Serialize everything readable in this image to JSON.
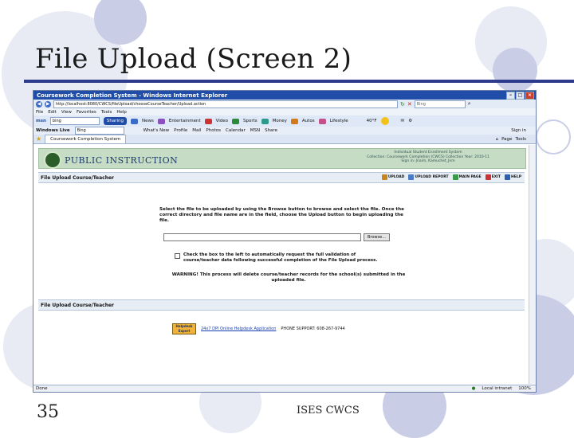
{
  "slide": {
    "title": "File Upload (Screen 2)",
    "number": "35",
    "footer": "ISES CWCS"
  },
  "browser": {
    "window_title": "Coursework Completion System - Windows Internet Explorer",
    "address": "http://localhost:8080/CWCS/fileUpload/chooseCourseTeacher/Upload.action",
    "search_placeholder": "Bing",
    "menu": [
      "File",
      "Edit",
      "View",
      "Favorites",
      "Tools",
      "Help"
    ],
    "msn": {
      "search_value": "bing",
      "button": "Sharing",
      "items": [
        "News",
        "Entertainment",
        "Video",
        "Sports",
        "Money",
        "Autos",
        "Lifestyle"
      ],
      "weather": "40°F"
    },
    "live": {
      "label": "Windows Live",
      "search_value": "Bing",
      "items": [
        "What's New",
        "Profile",
        "Mail",
        "Photos",
        "Calendar",
        "MSN",
        "Share"
      ],
      "sign_in": "Sign in"
    },
    "tab": "Coursework Completion System",
    "tab_tools": [
      "Page",
      "Tools"
    ],
    "status": {
      "left": "Done",
      "zone": "Local intranet",
      "zoom": "100%"
    }
  },
  "app": {
    "logo_text": "PUBLIC INSTRUCTION",
    "header_info": [
      "Individual Student Enrollment System",
      "Collection: Coursework Completion (CWCS)   Collection Year: 2010-11",
      "Sign in: Jnaim, Kamuchet_Jnm"
    ],
    "section_title": "File Upload Course/Teacher",
    "tools": [
      "UPLOAD",
      "UPLOAD REPORT",
      "MAIN PAGE",
      "EXIT",
      "HELP"
    ],
    "instructions": "Select the file to be uploaded by using the Browse button to browse and select the file. Once the correct directory and file name are in the field, choose the Upload button to begin uploading the file.",
    "browse_label": "Browse...",
    "checkbox_text_1": "Check the box to the left to automatically request the full validation of",
    "checkbox_text_2": "course/teacher data following successful completion of the File Upload process.",
    "warning": "WARNING! This process will delete course/teacher records for the school(s) submitted in the uploaded file.",
    "bottom_section_title": "File Upload Course/Teacher",
    "helpdesk_logo": "Helpdesk Expert",
    "helpdesk_link": "24x7 DPI Online Helpdesk Application",
    "phone_support": "PHONE SUPPORT: 608-267-9744"
  }
}
